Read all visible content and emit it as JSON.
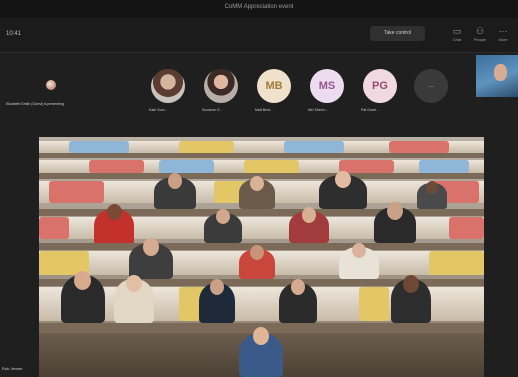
{
  "window": {
    "title": "CoMM Appreciation event"
  },
  "toolbar": {
    "timer": "10:41",
    "view_control_label": "Take control",
    "buttons": [
      {
        "name": "chat-button",
        "label": "Chat",
        "icon": "chat-icon"
      },
      {
        "name": "people-button",
        "label": "People",
        "icon": "people-icon"
      },
      {
        "name": "more-button",
        "label": "More",
        "icon": "more-icon"
      }
    ]
  },
  "participants_strip": {
    "presenter_caption": "Elizabeth Smith (Guest) is presenting",
    "avatars": [
      {
        "kind": "photo",
        "name": "Kate Som..."
      },
      {
        "kind": "photo",
        "name": "Suzanne O..."
      },
      {
        "kind": "initials",
        "initials": "MB",
        "name": "Matt Bent..."
      },
      {
        "kind": "initials",
        "initials": "MS",
        "name": "Mel Sheen..."
      },
      {
        "kind": "initials",
        "initials": "PG",
        "name": "Pat Grant..."
      },
      {
        "kind": "more",
        "label": "..."
      }
    ]
  },
  "stage": {
    "caption": "Rob Jenner"
  },
  "colors": {
    "background": "#1f1f1f",
    "seat_red": "#d9726b",
    "seat_yellow": "#e3c766",
    "seat_blue": "#8fb6d6"
  }
}
